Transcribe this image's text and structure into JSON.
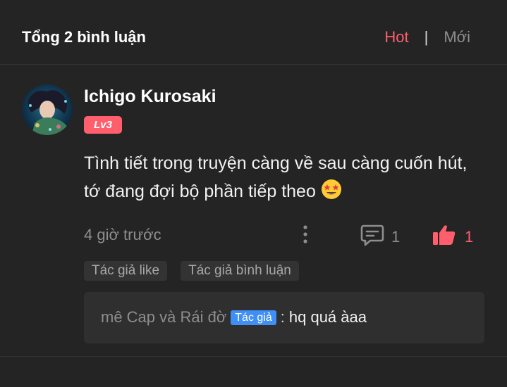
{
  "header": {
    "title": "Tổng 2 bình luận",
    "sort_hot": "Hot",
    "sort_separator": "|",
    "sort_new": "Mới",
    "active_sort": "Hot"
  },
  "comment": {
    "username": "Ichigo Kurosaki",
    "level": "Lv3",
    "content": "Tình tiết trong truyện càng về sau càng cuốn hút, tớ đang đợi bộ phần tiếp theo",
    "emoji": "star-struck-emoji",
    "time": "4 giờ trước",
    "reply_count": "1",
    "like_count": "1",
    "tags": [
      "Tác giả like",
      "Tác giả bình luận"
    ],
    "reply": {
      "author": "mê Cap và Rái đờ",
      "badge": "Tác giả",
      "colon": ":",
      "text": "hq quá àaa"
    }
  },
  "colors": {
    "accent": "#ff5f6d",
    "background": "#242424",
    "author_badge": "#3f8ff7"
  }
}
